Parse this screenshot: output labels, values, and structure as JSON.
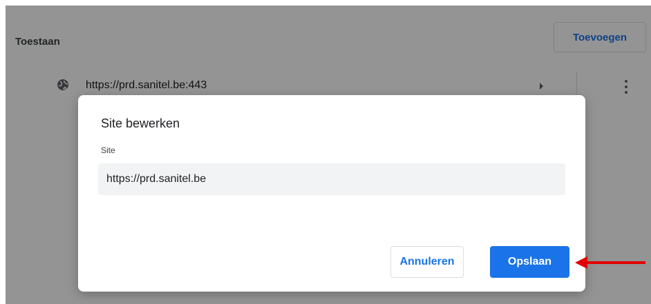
{
  "settings": {
    "section_title": "Toestaan",
    "add_button_label": "Toevoegen",
    "site_row": {
      "url": "https://prd.sanitel.be:443"
    }
  },
  "dialog": {
    "title": "Site bewerken",
    "field_label": "Site",
    "field_value": "https://prd.sanitel.be",
    "cancel_label": "Annuleren",
    "save_label": "Opslaan"
  },
  "colors": {
    "accent": "#1a73e8",
    "annotation_arrow": "#e00000",
    "scrim": "rgba(0,0,0,0.42)"
  },
  "icons": {
    "site": "globe-icon",
    "row_expand": "triangle-right-icon",
    "row_menu": "more-vert-icon"
  }
}
